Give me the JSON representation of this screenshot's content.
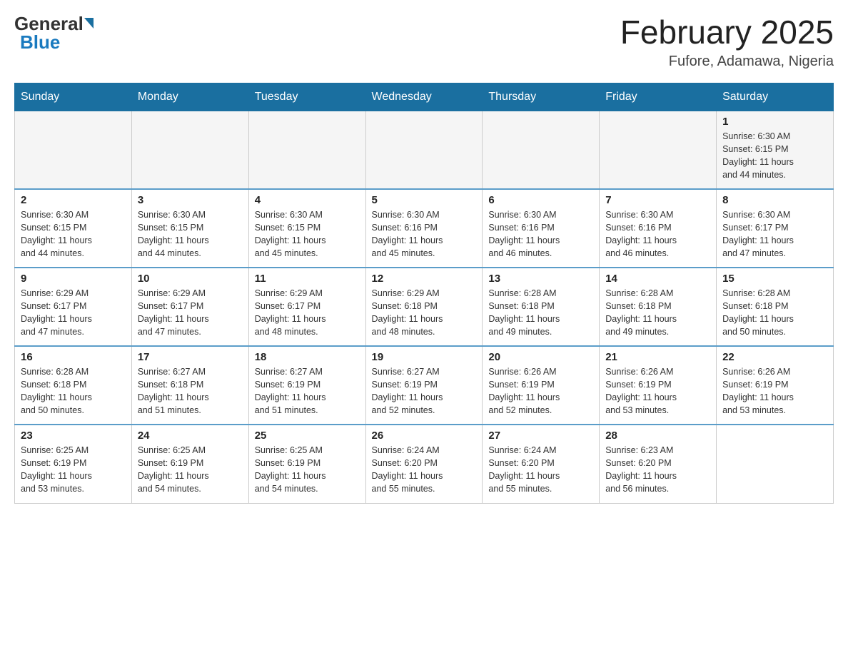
{
  "header": {
    "logo_general": "General",
    "logo_blue": "Blue",
    "month_title": "February 2025",
    "location": "Fufore, Adamawa, Nigeria"
  },
  "days_of_week": [
    "Sunday",
    "Monday",
    "Tuesday",
    "Wednesday",
    "Thursday",
    "Friday",
    "Saturday"
  ],
  "weeks": [
    [
      {
        "day": "",
        "info": ""
      },
      {
        "day": "",
        "info": ""
      },
      {
        "day": "",
        "info": ""
      },
      {
        "day": "",
        "info": ""
      },
      {
        "day": "",
        "info": ""
      },
      {
        "day": "",
        "info": ""
      },
      {
        "day": "1",
        "info": "Sunrise: 6:30 AM\nSunset: 6:15 PM\nDaylight: 11 hours\nand 44 minutes."
      }
    ],
    [
      {
        "day": "2",
        "info": "Sunrise: 6:30 AM\nSunset: 6:15 PM\nDaylight: 11 hours\nand 44 minutes."
      },
      {
        "day": "3",
        "info": "Sunrise: 6:30 AM\nSunset: 6:15 PM\nDaylight: 11 hours\nand 44 minutes."
      },
      {
        "day": "4",
        "info": "Sunrise: 6:30 AM\nSunset: 6:15 PM\nDaylight: 11 hours\nand 45 minutes."
      },
      {
        "day": "5",
        "info": "Sunrise: 6:30 AM\nSunset: 6:16 PM\nDaylight: 11 hours\nand 45 minutes."
      },
      {
        "day": "6",
        "info": "Sunrise: 6:30 AM\nSunset: 6:16 PM\nDaylight: 11 hours\nand 46 minutes."
      },
      {
        "day": "7",
        "info": "Sunrise: 6:30 AM\nSunset: 6:16 PM\nDaylight: 11 hours\nand 46 minutes."
      },
      {
        "day": "8",
        "info": "Sunrise: 6:30 AM\nSunset: 6:17 PM\nDaylight: 11 hours\nand 47 minutes."
      }
    ],
    [
      {
        "day": "9",
        "info": "Sunrise: 6:29 AM\nSunset: 6:17 PM\nDaylight: 11 hours\nand 47 minutes."
      },
      {
        "day": "10",
        "info": "Sunrise: 6:29 AM\nSunset: 6:17 PM\nDaylight: 11 hours\nand 47 minutes."
      },
      {
        "day": "11",
        "info": "Sunrise: 6:29 AM\nSunset: 6:17 PM\nDaylight: 11 hours\nand 48 minutes."
      },
      {
        "day": "12",
        "info": "Sunrise: 6:29 AM\nSunset: 6:18 PM\nDaylight: 11 hours\nand 48 minutes."
      },
      {
        "day": "13",
        "info": "Sunrise: 6:28 AM\nSunset: 6:18 PM\nDaylight: 11 hours\nand 49 minutes."
      },
      {
        "day": "14",
        "info": "Sunrise: 6:28 AM\nSunset: 6:18 PM\nDaylight: 11 hours\nand 49 minutes."
      },
      {
        "day": "15",
        "info": "Sunrise: 6:28 AM\nSunset: 6:18 PM\nDaylight: 11 hours\nand 50 minutes."
      }
    ],
    [
      {
        "day": "16",
        "info": "Sunrise: 6:28 AM\nSunset: 6:18 PM\nDaylight: 11 hours\nand 50 minutes."
      },
      {
        "day": "17",
        "info": "Sunrise: 6:27 AM\nSunset: 6:18 PM\nDaylight: 11 hours\nand 51 minutes."
      },
      {
        "day": "18",
        "info": "Sunrise: 6:27 AM\nSunset: 6:19 PM\nDaylight: 11 hours\nand 51 minutes."
      },
      {
        "day": "19",
        "info": "Sunrise: 6:27 AM\nSunset: 6:19 PM\nDaylight: 11 hours\nand 52 minutes."
      },
      {
        "day": "20",
        "info": "Sunrise: 6:26 AM\nSunset: 6:19 PM\nDaylight: 11 hours\nand 52 minutes."
      },
      {
        "day": "21",
        "info": "Sunrise: 6:26 AM\nSunset: 6:19 PM\nDaylight: 11 hours\nand 53 minutes."
      },
      {
        "day": "22",
        "info": "Sunrise: 6:26 AM\nSunset: 6:19 PM\nDaylight: 11 hours\nand 53 minutes."
      }
    ],
    [
      {
        "day": "23",
        "info": "Sunrise: 6:25 AM\nSunset: 6:19 PM\nDaylight: 11 hours\nand 53 minutes."
      },
      {
        "day": "24",
        "info": "Sunrise: 6:25 AM\nSunset: 6:19 PM\nDaylight: 11 hours\nand 54 minutes."
      },
      {
        "day": "25",
        "info": "Sunrise: 6:25 AM\nSunset: 6:19 PM\nDaylight: 11 hours\nand 54 minutes."
      },
      {
        "day": "26",
        "info": "Sunrise: 6:24 AM\nSunset: 6:20 PM\nDaylight: 11 hours\nand 55 minutes."
      },
      {
        "day": "27",
        "info": "Sunrise: 6:24 AM\nSunset: 6:20 PM\nDaylight: 11 hours\nand 55 minutes."
      },
      {
        "day": "28",
        "info": "Sunrise: 6:23 AM\nSunset: 6:20 PM\nDaylight: 11 hours\nand 56 minutes."
      },
      {
        "day": "",
        "info": ""
      }
    ]
  ]
}
